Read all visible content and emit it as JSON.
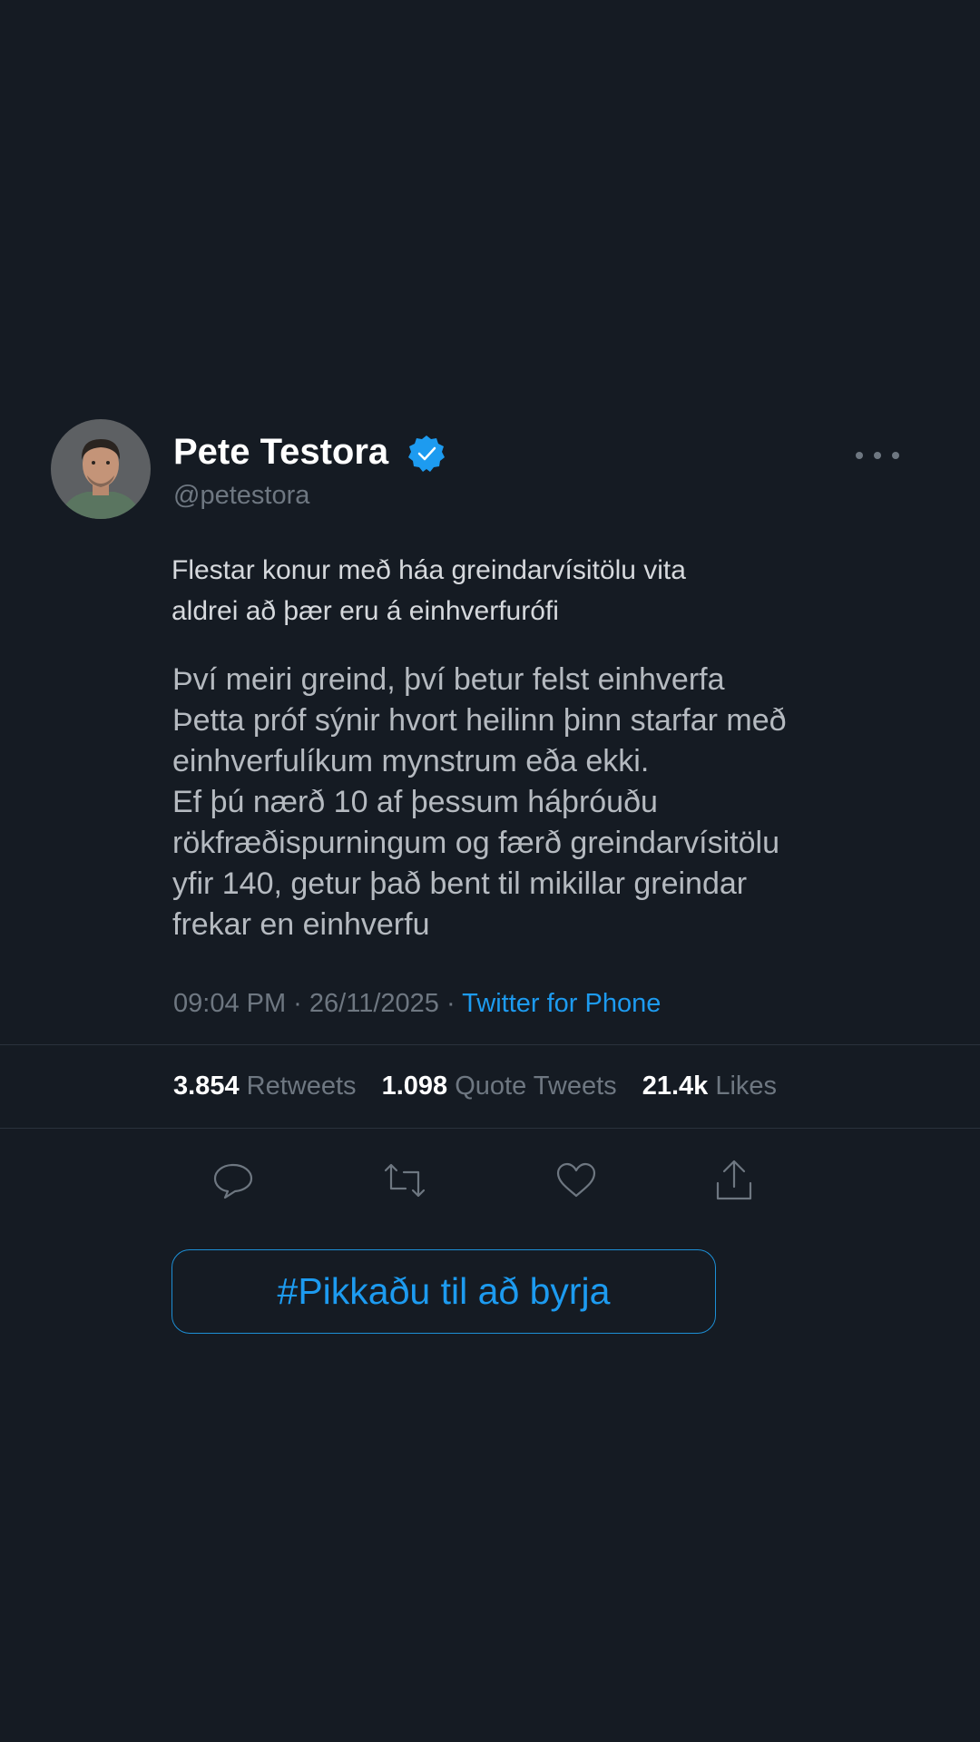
{
  "author": {
    "display_name": "Pete Testora",
    "handle": "@petestora",
    "verified_icon": "verified-badge-icon",
    "avatar_icon": "profile-photo"
  },
  "tweet": {
    "headline_lines": [
      "Flestar konur með háa greindarvísitölu vita",
      "aldrei að þær eru á einhverfurófi"
    ],
    "body_lines": [
      "Því meiri greind, því betur felst einhverfa",
      "Þetta próf sýnir hvort heilinn þinn starfar með",
      "einhverfulíkum mynstrum eða ekki.",
      "Ef þú nærð 10 af þessum háþróuðu",
      "rökfræðispurningum og færð greindarvísitölu",
      "yfir 140, getur það bent til mikillar greindar",
      "frekar en einhverfu"
    ],
    "timestamp": "09:04 PM · 26/11/2025 · ",
    "source": "Twitter for Phone"
  },
  "stats": {
    "retweets_count": "3.854",
    "retweets_label": "Retweets",
    "quotes_count": "1.098",
    "quotes_label": "Quote Tweets",
    "likes_count": "21.4k",
    "likes_label": "Likes"
  },
  "actions": {
    "icons": [
      "reply-icon",
      "retweet-icon",
      "like-icon",
      "share-icon"
    ]
  },
  "cta": {
    "label": "#Pikkaðu til að byrja"
  },
  "colors": {
    "background": "#151b23",
    "accent": "#1d9bf0",
    "muted": "#6e7781",
    "divider": "#2a323c"
  }
}
